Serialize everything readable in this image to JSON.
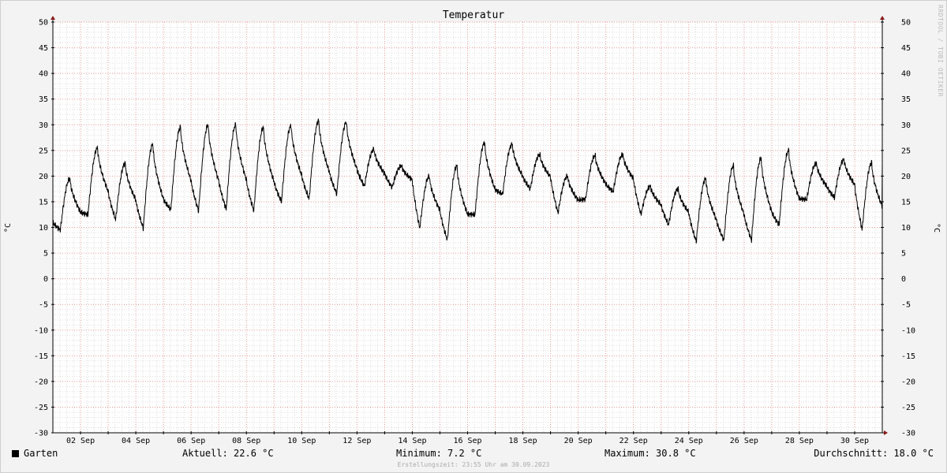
{
  "chart_data": {
    "type": "line",
    "title": "Temperatur",
    "ylabel": "°C",
    "ylabel_right": "°C",
    "ylim": [
      -30,
      50
    ],
    "xlim": [
      0,
      30
    ],
    "yticks": [
      -30,
      -25,
      -20,
      -15,
      -10,
      -5,
      0,
      5,
      10,
      15,
      20,
      25,
      30,
      35,
      40,
      45,
      50
    ],
    "xticks": [
      {
        "x": 1,
        "label": "02 Sep"
      },
      {
        "x": 3,
        "label": "04 Sep"
      },
      {
        "x": 5,
        "label": "06 Sep"
      },
      {
        "x": 7,
        "label": "08 Sep"
      },
      {
        "x": 9,
        "label": "10 Sep"
      },
      {
        "x": 11,
        "label": "12 Sep"
      },
      {
        "x": 13,
        "label": "14 Sep"
      },
      {
        "x": 15,
        "label": "16 Sep"
      },
      {
        "x": 17,
        "label": "18 Sep"
      },
      {
        "x": 19,
        "label": "20 Sep"
      },
      {
        "x": 21,
        "label": "22 Sep"
      },
      {
        "x": 23,
        "label": "24 Sep"
      },
      {
        "x": 25,
        "label": "26 Sep"
      },
      {
        "x": 27,
        "label": "28 Sep"
      },
      {
        "x": 29,
        "label": "30 Sep"
      }
    ],
    "grid": true,
    "series": [
      {
        "name": "Garten",
        "color": "#000000",
        "daily_extremes": [
          {
            "day": 0,
            "min": 9.5,
            "max": 19.5
          },
          {
            "day": 1,
            "min": 12.5,
            "max": 25.5
          },
          {
            "day": 2,
            "min": 11.5,
            "max": 22.5
          },
          {
            "day": 3,
            "min": 9.8,
            "max": 26.2
          },
          {
            "day": 4,
            "min": 13.5,
            "max": 29.5
          },
          {
            "day": 5,
            "min": 13.2,
            "max": 30.0
          },
          {
            "day": 6,
            "min": 13.5,
            "max": 30.0
          },
          {
            "day": 7,
            "min": 13.2,
            "max": 29.5
          },
          {
            "day": 8,
            "min": 15.0,
            "max": 29.8
          },
          {
            "day": 9,
            "min": 15.5,
            "max": 30.8
          },
          {
            "day": 10,
            "min": 16.5,
            "max": 30.5
          },
          {
            "day": 11,
            "min": 18.0,
            "max": 25.2
          },
          {
            "day": 12,
            "min": 17.8,
            "max": 22.0
          },
          {
            "day": 13,
            "min": 9.8,
            "max": 20.0
          },
          {
            "day": 14,
            "min": 7.5,
            "max": 22.0
          },
          {
            "day": 15,
            "min": 12.5,
            "max": 26.5
          },
          {
            "day": 16,
            "min": 16.5,
            "max": 26.2
          },
          {
            "day": 17,
            "min": 17.5,
            "max": 24.2
          },
          {
            "day": 18,
            "min": 12.8,
            "max": 20.0
          },
          {
            "day": 19,
            "min": 15.5,
            "max": 24.0
          },
          {
            "day": 20,
            "min": 17.0,
            "max": 24.2
          },
          {
            "day": 21,
            "min": 12.5,
            "max": 18.0
          },
          {
            "day": 22,
            "min": 10.5,
            "max": 17.5
          },
          {
            "day": 23,
            "min": 7.2,
            "max": 19.5
          },
          {
            "day": 24,
            "min": 7.5,
            "max": 22.0
          },
          {
            "day": 25,
            "min": 7.5,
            "max": 23.5
          },
          {
            "day": 26,
            "min": 10.5,
            "max": 25.0
          },
          {
            "day": 27,
            "min": 15.5,
            "max": 22.5
          },
          {
            "day": 28,
            "min": 15.8,
            "max": 23.2
          },
          {
            "day": 29,
            "min": 9.5,
            "max": 22.6
          }
        ]
      }
    ]
  },
  "legend": {
    "name": "Garten",
    "current": "Aktuell: 22.6 °C",
    "minimum": "Minimum: 7.2 °C",
    "maximum": "Maximum: 30.8 °C",
    "average": "Durchschnitt: 18.0 °C"
  },
  "footer": {
    "created": "Erstellungszeit: 23:55 Uhr am 30.09.2023"
  },
  "watermark": "RRDTOOL / TOBI OETIKER",
  "colors": {
    "background": "#f3f3f3",
    "plot": "#ffffff",
    "major_grid": "#e99a9a",
    "minor_grid": "#dddddd",
    "axis": "#000000",
    "arrow": "#8b1a1a"
  }
}
